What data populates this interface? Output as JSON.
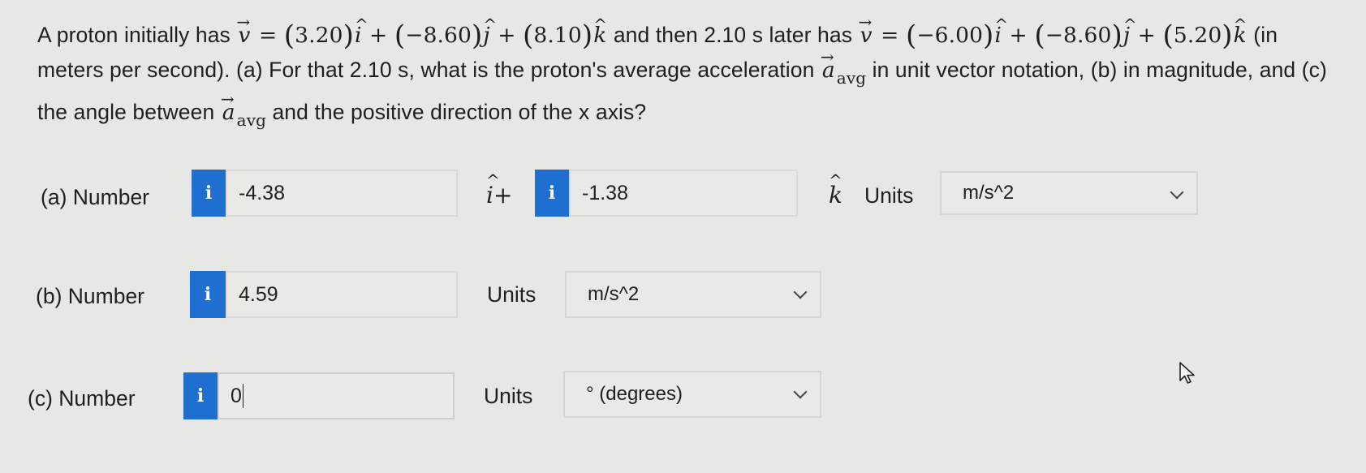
{
  "question": {
    "t1": "A proton initially has ",
    "v": "v",
    "eq": " = ",
    "a1": "3.20",
    "i": "i",
    "plus": " + ",
    "a2": "−8.60",
    "j": "j",
    "a3": "8.10",
    "k": "k",
    "t2": " and then 2.10 s later has ",
    "b1": "−6.00",
    "b2": "−8.60",
    "b3": "5.20",
    "t3": " (in meters per second). (a) For that 2.10 s, what is the proton's average acceleration ",
    "a": "a",
    "avg": "avg",
    "t4": " in unit vector notation, (b) in magnitude, and (c) the angle between ",
    "t5": " and the positive direction of the x axis?"
  },
  "parts": {
    "a": {
      "label": "(a)   Number",
      "info_icon": "info-icon",
      "value_i": "-4.38",
      "i_sym": "i+",
      "value_k": "-1.38",
      "k_sym": "k",
      "units_label": "Units",
      "units_value": "m/s^2"
    },
    "b": {
      "label": "(b)   Number",
      "value": "4.59",
      "units_label": "Units",
      "units_value": "m/s^2"
    },
    "c": {
      "label": "(c)   Number",
      "value": "0",
      "units_label": "Units",
      "units_value": "° (degrees)"
    }
  },
  "cursor_icon": "mouse-pointer-icon"
}
